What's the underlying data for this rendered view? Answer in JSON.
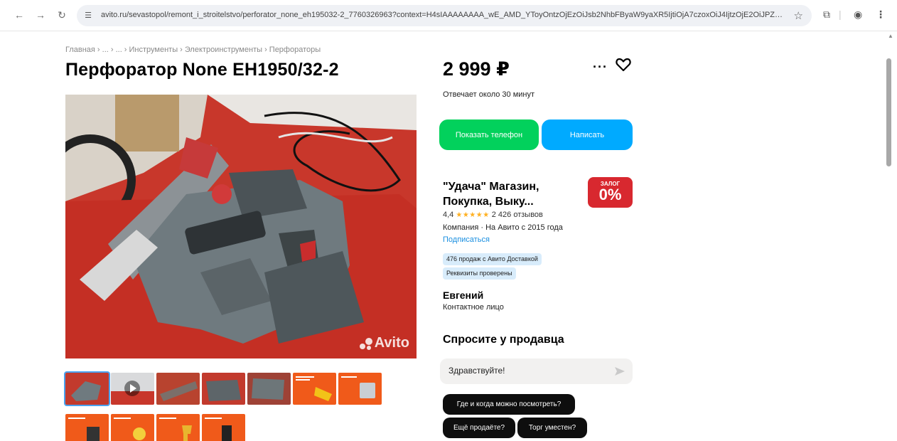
{
  "browser": {
    "url": "avito.ru/sevastopol/remont_i_stroitelstvo/perforator_none_eh195032-2_7760326963?context=H4sIAAAAAAAA_wE_AMD_YToyOntzOjEzOiJsb2NhbFByaW9yaXR5IjtiOjA7czoxOiJ4IjtzOjE2OiJPZ01..."
  },
  "breadcrumb": "Главная › ... › ... › Инструменты › Электроинструменты › Перфораторы",
  "listing": {
    "title": "Перфоратор None EH1950/32-2",
    "price": "2 999 ₽",
    "reply_time": "Отвечает около 30 минут",
    "show_phone_label": "Показать телефон",
    "write_label": "Написать",
    "watermark": "Avito"
  },
  "seller": {
    "name": "\"Удача\" Магазин, Покупка, Выку...",
    "rating": "4,4",
    "stars": "★★★★★",
    "reviews": "2 426 отзывов",
    "company_info": "Компания · На Авито с 2015 года",
    "subscribe_label": "Подписаться",
    "chip_sales": "476 продаж с Авито Доставкой",
    "chip_verified": "Реквизиты проверены",
    "badge_top": "ЗАЛОГ",
    "badge_main": "0%"
  },
  "contact": {
    "name": "Евгений",
    "role": "Контактное лицо"
  },
  "ask": {
    "title": "Спросите у продавца",
    "input_value": "Здравствуйте!",
    "quick_questions": [
      "Где и когда можно посмотреть?",
      "Ещё продаёте?",
      "Торг уместен?"
    ]
  },
  "thumbnails": [
    {
      "kind": "photo",
      "color": "#c23a2d"
    },
    {
      "kind": "video",
      "color": "#e8e8e8"
    },
    {
      "kind": "photo",
      "color": "#b8432f"
    },
    {
      "kind": "photo",
      "color": "#8b5a4a"
    },
    {
      "kind": "photo",
      "color": "#7d6a66"
    },
    {
      "kind": "promo",
      "color": "#f05a1a"
    },
    {
      "kind": "promo",
      "color": "#f05a1a"
    },
    {
      "kind": "promo",
      "color": "#f05a1a"
    },
    {
      "kind": "promo",
      "color": "#f05a1a"
    },
    {
      "kind": "promo",
      "color": "#f05a1a"
    },
    {
      "kind": "promo",
      "color": "#f05a1a"
    }
  ],
  "colors": {
    "phone_button": "#02d15c",
    "write_button": "#00aaff",
    "link": "#1a8fe0",
    "badge": "#d8282f"
  }
}
